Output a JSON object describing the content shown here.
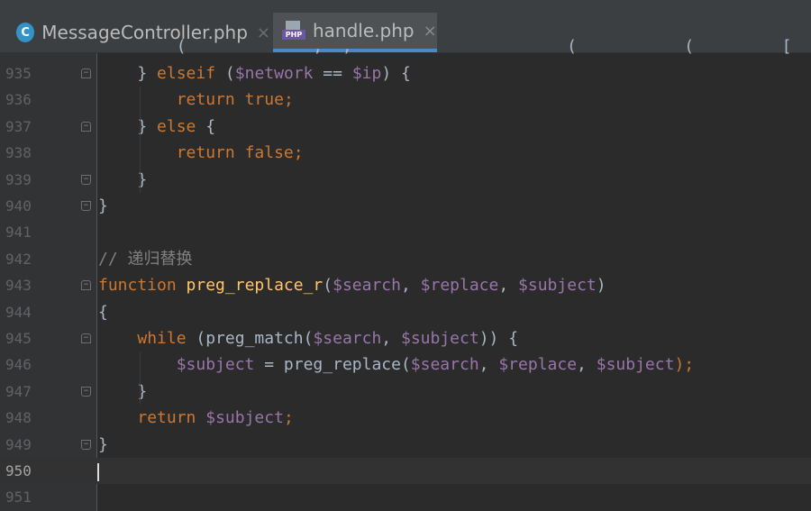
{
  "tabs": [
    {
      "label": "MessageController.php",
      "icon": "class-c-icon",
      "active": false,
      "icon_letter": "C"
    },
    {
      "label": "handle.php",
      "icon": "php-file-icon",
      "active": true,
      "icon_text": "PHP"
    }
  ],
  "close_glyph": "×",
  "lines": [
    {
      "num": "935",
      "fold": "start",
      "tokens": [
        [
          "",
          "    "
        ],
        [
          "p",
          "} "
        ],
        [
          "kw",
          "elseif"
        ],
        [
          "p",
          " ("
        ],
        [
          "var",
          "$network"
        ],
        [
          "p",
          " == "
        ],
        [
          "var",
          "$ip"
        ],
        [
          "p",
          ") {"
        ]
      ]
    },
    {
      "num": "936",
      "fold": "",
      "tokens": [
        [
          "",
          "        "
        ],
        [
          "kw",
          "return"
        ],
        [
          "p",
          " "
        ],
        [
          "kw",
          "true"
        ],
        [
          "kw",
          ";"
        ]
      ]
    },
    {
      "num": "937",
      "fold": "start",
      "tokens": [
        [
          "",
          "    "
        ],
        [
          "p",
          "} "
        ],
        [
          "kw",
          "else"
        ],
        [
          "p",
          " {"
        ]
      ]
    },
    {
      "num": "938",
      "fold": "",
      "tokens": [
        [
          "",
          "        "
        ],
        [
          "kw",
          "return"
        ],
        [
          "p",
          " "
        ],
        [
          "kw",
          "false"
        ],
        [
          "kw",
          ";"
        ]
      ]
    },
    {
      "num": "939",
      "fold": "end",
      "tokens": [
        [
          "",
          "    "
        ],
        [
          "p",
          "}"
        ]
      ]
    },
    {
      "num": "940",
      "fold": "end",
      "tokens": [
        [
          "p",
          "}"
        ]
      ]
    },
    {
      "num": "941",
      "fold": "",
      "tokens": []
    },
    {
      "num": "942",
      "fold": "",
      "tokens": [
        [
          "cm",
          "// 递归替换"
        ]
      ]
    },
    {
      "num": "943",
      "fold": "start",
      "tokens": [
        [
          "kw",
          "function"
        ],
        [
          "p",
          " "
        ],
        [
          "fn",
          "preg_replace_r"
        ],
        [
          "p",
          "("
        ],
        [
          "var",
          "$search"
        ],
        [
          "p",
          ", "
        ],
        [
          "var",
          "$replace"
        ],
        [
          "p",
          ", "
        ],
        [
          "var",
          "$subject"
        ],
        [
          "p",
          ")"
        ]
      ]
    },
    {
      "num": "944",
      "fold": "",
      "tokens": [
        [
          "p",
          "{"
        ]
      ]
    },
    {
      "num": "945",
      "fold": "start",
      "tokens": [
        [
          "",
          "    "
        ],
        [
          "kw",
          "while"
        ],
        [
          "p",
          " (preg_match("
        ],
        [
          "var",
          "$search"
        ],
        [
          "p",
          ", "
        ],
        [
          "var",
          "$subject"
        ],
        [
          "p",
          ")) {"
        ]
      ]
    },
    {
      "num": "946",
      "fold": "",
      "tokens": [
        [
          "",
          "        "
        ],
        [
          "var",
          "$subject"
        ],
        [
          "p",
          " = preg_replace("
        ],
        [
          "var",
          "$search"
        ],
        [
          "p",
          ", "
        ],
        [
          "var",
          "$replace"
        ],
        [
          "p",
          ", "
        ],
        [
          "var",
          "$subject"
        ],
        [
          "kw",
          ");"
        ]
      ]
    },
    {
      "num": "947",
      "fold": "end",
      "tokens": [
        [
          "",
          "    "
        ],
        [
          "p",
          "}"
        ]
      ]
    },
    {
      "num": "948",
      "fold": "",
      "tokens": [
        [
          "",
          "    "
        ],
        [
          "kw",
          "return"
        ],
        [
          "p",
          " "
        ],
        [
          "var",
          "$subject"
        ],
        [
          "kw",
          ";"
        ]
      ]
    },
    {
      "num": "949",
      "fold": "end",
      "tokens": [
        [
          "p",
          "}"
        ]
      ]
    },
    {
      "num": "950",
      "fold": "",
      "current": true,
      "tokens": []
    },
    {
      "num": "951",
      "fold": "",
      "tokens": []
    }
  ],
  "partial_top_line": "        (             ,  ,                      (           (         [  ])"
}
